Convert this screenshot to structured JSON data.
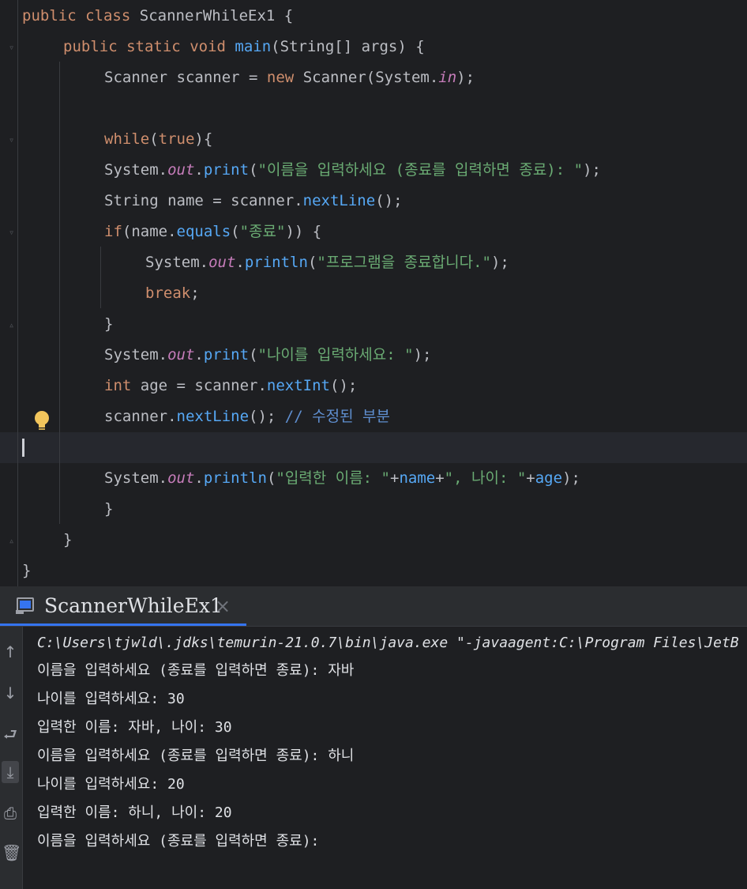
{
  "editor": {
    "lines": {
      "l1": {
        "kw1": "public",
        "kw2": "class",
        "name": "ScannerWhileEx1",
        "brace": " {"
      },
      "l2": {
        "kw1": "public",
        "kw2": "static",
        "kw3": "void",
        "method": "main",
        "open": "(",
        "type": "String",
        "arr": "[] ",
        "param": "args",
        "close": ") {"
      },
      "l3": {
        "type": "Scanner",
        "var": " scanner = ",
        "kw": "new",
        "ctor": " Scanner(System.",
        "field": "in",
        "end": ");"
      },
      "l5": {
        "kw": "while",
        "open": "(",
        "val": "true",
        "close": "){"
      },
      "l6": {
        "obj": "System.",
        "field": "out",
        "dot": ".",
        "fn": "print",
        "open": "(",
        "str": "\"이름을 입력하세요 (종료를 입력하면 종료): \"",
        "end": ");"
      },
      "l7": {
        "type": "String",
        "var": " name = scanner.",
        "fn": "nextLine",
        "end": "();"
      },
      "l8": {
        "kw": "if",
        "open": "(name.",
        "fn": "equals",
        "open2": "(",
        "str": "\"종료\"",
        "close": ")) {"
      },
      "l9": {
        "obj": "System.",
        "field": "out",
        "dot": ".",
        "fn": "println",
        "open": "(",
        "str": "\"프로그램을 종료합니다.\"",
        "end": ");"
      },
      "l10": {
        "kw": "break",
        "end": ";"
      },
      "l11": {
        "text": "}"
      },
      "l12": {
        "obj": "System.",
        "field": "out",
        "dot": ".",
        "fn": "print",
        "open": "(",
        "str": "\"나이를 입력하세요: \"",
        "end": ");"
      },
      "l13": {
        "kw": "int",
        "var": " age = scanner.",
        "fn": "nextInt",
        "end": "();"
      },
      "l14": {
        "obj": "scanner.",
        "fn": "nextLine",
        "end": "(); ",
        "cmt": "// 수정된 부분"
      },
      "l16": {
        "obj": "System.",
        "field": "out",
        "dot": ".",
        "fn": "println",
        "open": "(",
        "str1": "\"입력한 이름: \"",
        "plus1": "+",
        "v1": "name",
        "plus2": "+",
        "str2": "\", 나이: \"",
        "plus3": "+",
        "v2": "age",
        "end": ");"
      },
      "l17": {
        "text": "}"
      },
      "l18": {
        "text": "}"
      },
      "l19": {
        "text": "}"
      }
    }
  },
  "run": {
    "tab_label": "ScannerWhileEx1",
    "close_glyph": "×",
    "tools": {
      "up": "↑",
      "down": "↓",
      "wrap": "⮐",
      "scroll": "⤓",
      "print": "⎙",
      "trash": "🗑"
    },
    "output": [
      "C:\\Users\\tjwld\\.jdks\\temurin-21.0.7\\bin\\java.exe \"-javaagent:C:\\Program Files\\JetB",
      "이름을 입력하세요 (종료를 입력하면 종료): 자바",
      "나이를 입력하세요: 30",
      "입력한 이름: 자바, 나이: 30",
      "이름을 입력하세요 (종료를 입력하면 종료): 하니",
      "나이를 입력하세요: 20",
      "입력한 이름: 하니, 나이: 20",
      "이름을 입력하세요 (종료를 입력하면 종료):"
    ]
  }
}
